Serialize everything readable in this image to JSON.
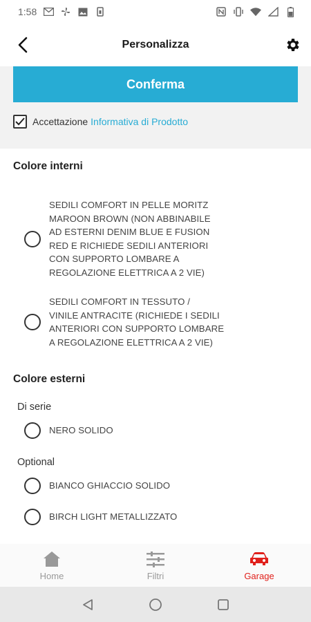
{
  "status_bar": {
    "time": "1:58"
  },
  "app_bar": {
    "title": "Personalizza"
  },
  "top_panel": {
    "confirm_label": "Conferma",
    "accept_prefix": "Accettazione",
    "accept_link": "Informativa di Prodotto",
    "accepted": true
  },
  "interior": {
    "title": "Colore interni",
    "options": [
      {
        "lines": [
          "SEDILI COMFORT IN PELLE MORITZ",
          "MAROON BROWN (NON ABBINABILE",
          "AD ESTERNI DENIM BLUE E FUSION",
          "RED E RICHIEDE SEDILI ANTERIORI",
          "CON SUPPORTO LOMBARE A",
          "REGOLAZIONE ELETTRICA A 2 VIE)"
        ],
        "selected": false
      },
      {
        "lines": [
          "SEDILI COMFORT IN TESSUTO /",
          "VINILE ANTRACITE (RICHIEDE I SEDILI",
          "ANTERIORI CON SUPPORTO LOMBARE",
          "A REGOLAZIONE ELETTRICA A 2 VIE)"
        ],
        "selected": false
      }
    ]
  },
  "exterior": {
    "title": "Colore esterni",
    "standard_label": "Di serie",
    "standard_options": [
      {
        "label": "NERO SOLIDO",
        "selected": false
      }
    ],
    "optional_label": "Optional",
    "optional_options": [
      {
        "label": "BIANCO GHIACCIO SOLIDO",
        "selected": false
      },
      {
        "label": "BIRCH LIGHT METALLIZZATO",
        "selected": false
      }
    ]
  },
  "bottom_nav": {
    "items": [
      {
        "label": "Home",
        "icon": "home-icon",
        "active": false
      },
      {
        "label": "Filtri",
        "icon": "filter-icon",
        "active": false
      },
      {
        "label": "Garage",
        "icon": "car-icon",
        "active": true
      }
    ]
  },
  "colors": {
    "accent": "#27acd4",
    "active_nav": "#e0201b",
    "panel_bg": "#f2f2f2"
  }
}
